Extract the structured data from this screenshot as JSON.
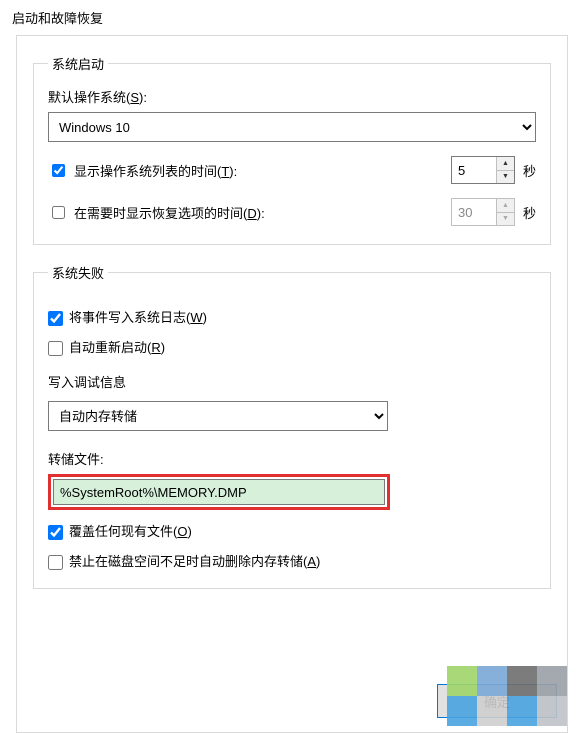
{
  "dialog_title": "启动和故障恢复",
  "startup": {
    "legend": "系统启动",
    "default_os_label_pre": "默认操作系统(",
    "default_os_hotkey": "S",
    "default_os_label_post": "):",
    "default_os_value": "Windows 10",
    "show_list_checked": true,
    "show_list_label_pre": "显示操作系统列表的时间(",
    "show_list_hotkey": "T",
    "show_list_label_post": "):",
    "show_list_seconds": "5",
    "show_recovery_checked": false,
    "show_recovery_label_pre": "在需要时显示恢复选项的时间(",
    "show_recovery_hotkey": "D",
    "show_recovery_label_post": "):",
    "show_recovery_seconds": "30",
    "seconds_unit": "秒"
  },
  "failure": {
    "legend": "系统失败",
    "write_eventlog_checked": true,
    "write_eventlog_label_pre": "将事件写入系统日志(",
    "write_eventlog_hotkey": "W",
    "write_eventlog_label_post": ")",
    "auto_restart_checked": false,
    "auto_restart_label_pre": "自动重新启动(",
    "auto_restart_hotkey": "R",
    "auto_restart_label_post": ")",
    "debug_info_label": "写入调试信息",
    "debug_info_value": "自动内存转储",
    "dump_file_label": "转储文件:",
    "dump_file_value": "%SystemRoot%\\MEMORY.DMP",
    "overwrite_checked": true,
    "overwrite_label_pre": "覆盖任何现有文件(",
    "overwrite_hotkey": "O",
    "overwrite_label_post": ")",
    "nodelete_checked": false,
    "nodelete_label_pre": "禁止在磁盘空间不足时自动删除内存转储(",
    "nodelete_hotkey": "A",
    "nodelete_label_post": ")"
  },
  "buttons": {
    "ok": "确定"
  }
}
